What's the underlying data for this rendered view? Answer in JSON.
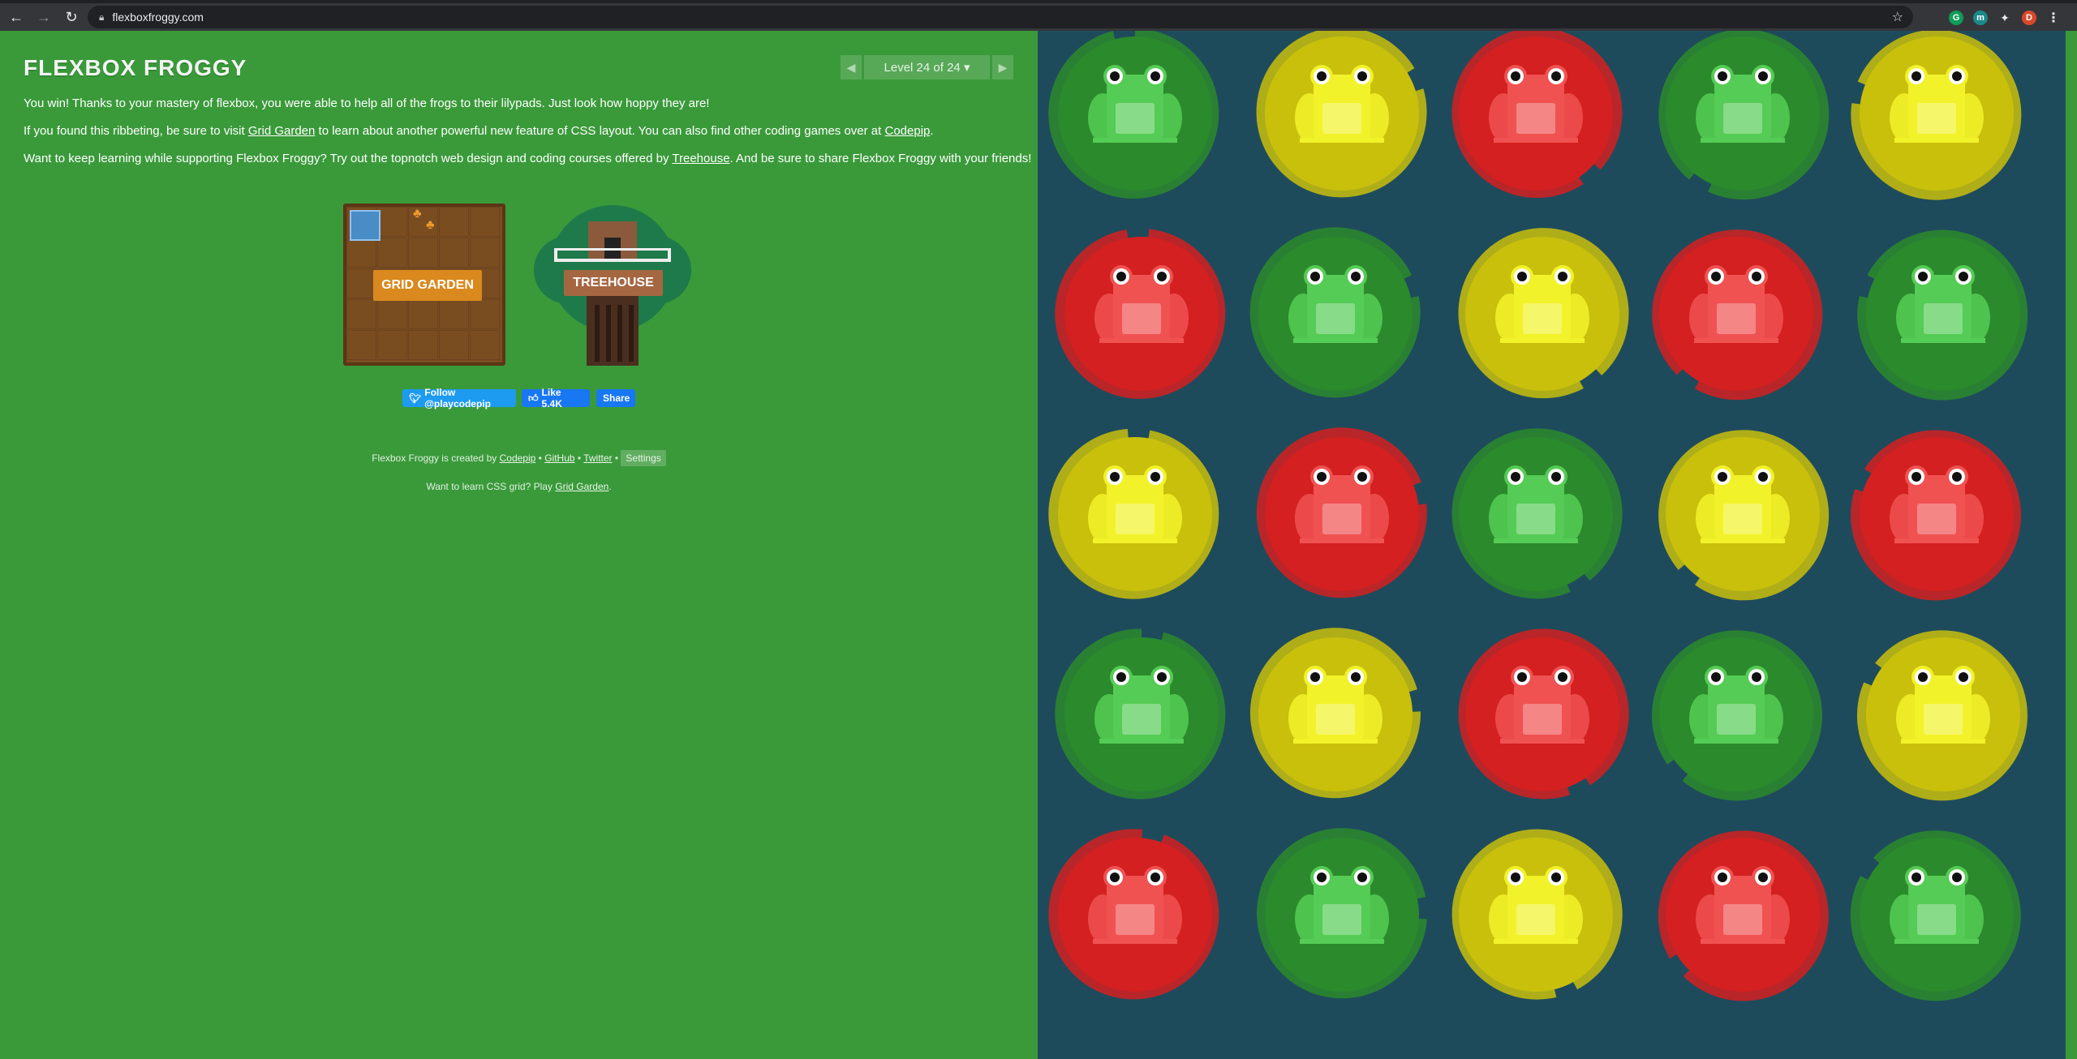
{
  "browser": {
    "url": "flexboxfroggy.com",
    "back_icon": "←",
    "forward_icon": "→",
    "reload_icon": "↻",
    "avatar_letter": "D"
  },
  "game": {
    "title": "FLEXBOX FROGGY",
    "level_indicator": "Level 24 of 24 ▾",
    "prev_arrow": "◀",
    "next_arrow": "▶",
    "win_text": "You win! Thanks to your mastery of flexbox, you were able to help all of the frogs to their lilypads. Just look how hoppy they are!",
    "p2_a": "If you found this ribbeting, be sure to visit ",
    "p2_link1": "Grid Garden",
    "p2_b": " to learn about another powerful new feature of CSS layout. You can also find other coding games over at ",
    "p2_link2": "Codepip",
    "p2_c": ".",
    "p3_a": "Want to keep learning while supporting Flexbox Froggy? Try out the topnotch web design and coding courses offered by ",
    "p3_link": "Treehouse",
    "p3_b": ". And be sure to share Flexbox Froggy with your friends!",
    "grid_garden_label": "GRID GARDEN",
    "treehouse_label": "TREEHOUSE",
    "twitter_label": "Follow @playcodepip",
    "fb_like_label": "Like 5.4K",
    "share_label": "Share",
    "credits_prefix": "Flexbox Froggy is created by ",
    "credits_codepip": "Codepip",
    "credits_sep1": " • ",
    "credits_github": "GitHub",
    "credits_sep2": " • ",
    "credits_twitter": "Twitter",
    "credits_sep3": " • ",
    "settings_label": "Settings",
    "grid_prompt_prefix": "Want to learn CSS grid? Play ",
    "grid_prompt_link": "Grid Garden",
    "grid_prompt_suffix": "."
  },
  "colors": {
    "green": "#3a9a3a",
    "board": "#1e4b5c",
    "pad_green": "#2b8a2b",
    "pad_yellow": "#c9c00c",
    "pad_red": "#d42020",
    "frog_green": "#55cc55",
    "frog_yellow": "#f2f22a",
    "frog_red": "#f05252"
  },
  "board": {
    "rows": [
      [
        "green",
        "yellow",
        "red",
        "green",
        "yellow"
      ],
      [
        "red",
        "green",
        "yellow",
        "red",
        "green"
      ],
      [
        "yellow",
        "red",
        "green",
        "yellow",
        "red"
      ],
      [
        "green",
        "yellow",
        "red",
        "green",
        "yellow"
      ],
      [
        "red",
        "green",
        "yellow",
        "red",
        "green"
      ]
    ]
  }
}
